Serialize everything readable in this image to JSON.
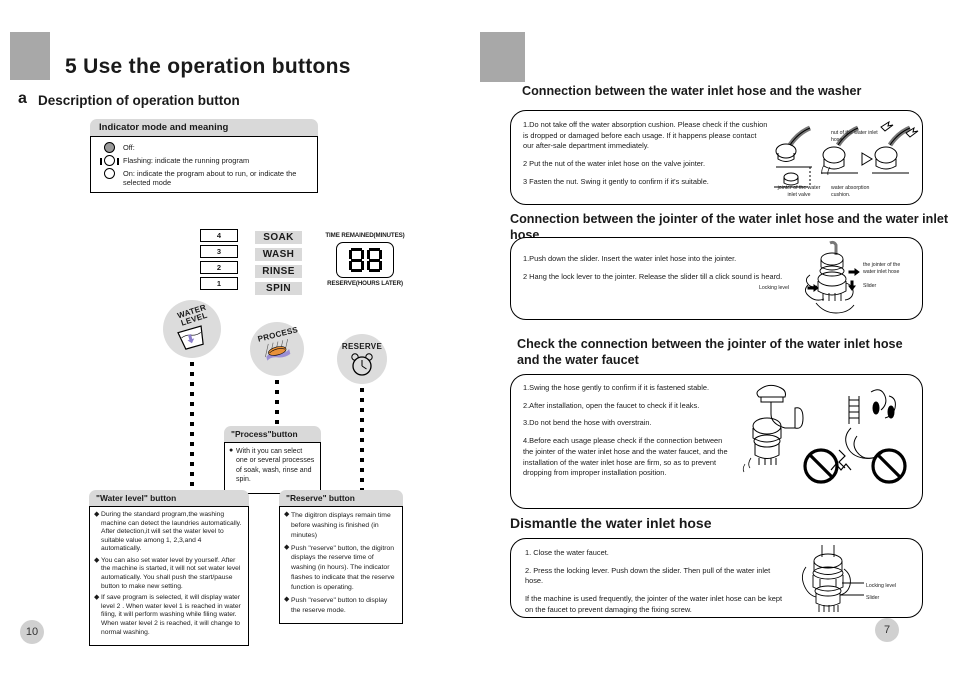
{
  "left_page": {
    "corner_tab": {
      "color": "#a8a8a8"
    },
    "chapter_title": "5 Use the  operation buttons",
    "sub_letter": "a",
    "sub_title": "Description of operation button",
    "indicator_box": {
      "header": "Indicator mode and meaning",
      "rows": [
        {
          "symbol": "led-off",
          "text": "Off:"
        },
        {
          "symbol": "led-flashing",
          "text": "Flashing: indicate the running program"
        },
        {
          "symbol": "led-on",
          "text": "On: indicate the program about to run, or indicate the selected mode"
        }
      ]
    },
    "panel": {
      "water_levels": [
        "4",
        "3",
        "2",
        "1"
      ],
      "programs": [
        "SOAK",
        "WASH",
        "RINSE",
        "SPIN"
      ],
      "display": {
        "top_label": "TIME REMAINED(MINUTES)",
        "value": "88",
        "bottom_label": "RESERVE(HOURS LATER)"
      },
      "knobs": [
        {
          "name": "water-level-knob",
          "label_line1": "WATER",
          "label_line2": "LEVEL"
        },
        {
          "name": "process-knob",
          "label_line1": "PROCESS",
          "label_line2": ""
        },
        {
          "name": "reserve-knob",
          "label_line1": "RESERVE",
          "label_line2": ""
        }
      ]
    },
    "callouts": [
      {
        "id": "process",
        "header": "\"Process\"button",
        "bullets": [
          "With it you can select one or several processes of soak, wash, rinse and spin."
        ]
      },
      {
        "id": "water_level",
        "header": "\"Water level\" button",
        "bullets": [
          "During the standard program,the washing machine can detect the laundries automatically. After detection,it will set the water level to suitable value among 1, 2,3,and 4 automatically.",
          "You can also set water level by yourself. After the machine is started, it will not set water level automatically. You shall  push the  start/pause button to make new setting.",
          "If  save  program is selected, it will display water level  2 . When water level  1  is reached in water filing, it will perform  washing while filing water. When water level  2  is reached, it will  change to normal washing."
        ]
      },
      {
        "id": "reserve",
        "header": "\"Reserve\" button",
        "bullets": [
          "The digitron displays remain time before washing is finished (in minutes)",
          "Push \"reserve\" button, the digitron displays the reserve time of washing (in hours). The indicator flashes to indicate that the reserve function is operating.",
          "Push \"reserve\" button to display the reserve mode."
        ]
      }
    ],
    "page_number": "10"
  },
  "right_page": {
    "corner_tab": {
      "color": "#a8a8a8"
    },
    "sections": [
      {
        "id": "inlet_hose_washer",
        "title": "Connection between the water inlet hose and the washer",
        "paragraphs": [
          "1.Do not take off the water absorption cushion. Please check if the cushion is dropped or damaged before each usage. If it happens please contact our after-sale department immediately.",
          "2 Put the nut of the water inlet hose on the valve jointer.",
          "3 Fasten the nut. Swing it gently to confirm if it's suitable."
        ],
        "art_labels": [
          "nut of the water inlet hose",
          "jointer of the water inlet valve",
          "water absorption cushion."
        ]
      },
      {
        "id": "jointer_inlet_hose",
        "title": "Connection between the jointer of the water inlet hose and the water inlet hose",
        "paragraphs": [
          "1.Push down the slider. Insert the water inlet hose into the jointer.",
          "2 Hang the lock lever to the jointer. Release the slider till a click sound is heard."
        ],
        "art_labels": [
          "the jointer of the water inlet hose",
          "Slider",
          "Locking level"
        ]
      },
      {
        "id": "check_connection",
        "title": "Check the connection between the jointer of the water inlet hose and the water faucet",
        "paragraphs": [
          "1.Swing the hose gently to confirm if it is fastened stable.",
          "2.After installation, open the faucet to check if it leaks.",
          "3.Do not bend the hose with overstrain.",
          "4.Before each usage please check if the connection between the jointer of the water inlet hose and the water faucet, and the installation of the water inlet hose are firm, so as to prevent dropping from improper installation position."
        ]
      },
      {
        "id": "dismantle",
        "title": "Dismantle the water inlet hose",
        "paragraphs": [
          "1. Close the water faucet.",
          "2. Press the locking lever. Push down the slider. Then pull of the water inlet hose.",
          "If the machine is used frequently, the jointer of the water inlet hose can be kept  on the faucet to prevent damaging the fixing screw."
        ],
        "art_labels": [
          "Locking level",
          "Slider"
        ]
      }
    ],
    "page_number": "7"
  }
}
